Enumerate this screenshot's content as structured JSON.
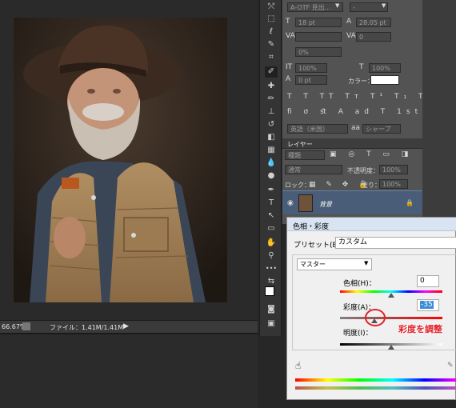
{
  "document": {
    "zoom": "66.67%",
    "file_info": "ファイル：1.41M/1.41M"
  },
  "character_panel": {
    "font_family": "A-OTF 見出...",
    "font_style": "-",
    "font_size": "18 pt",
    "leading": "28.05 pt",
    "kerning": "",
    "tracking": "0",
    "tsume": "0%",
    "vertical_scale": "100%",
    "horizontal_scale": "100%",
    "baseline_shift": "0 pt",
    "color_label": "カラー：",
    "language": "英語（米国）",
    "antialias": "シャープ"
  },
  "layers_panel": {
    "tab": "レイヤー",
    "filter": "種類",
    "blend_mode": "通常",
    "opacity_label": "不透明度：",
    "opacity_value": "100%",
    "lock_label": "ロック：",
    "fill_label": "塗り：",
    "fill_value": "100%",
    "layer_name": "背景"
  },
  "hue_sat_dialog": {
    "title": "色相・彩度",
    "preset_label": "プリセット(E)：",
    "preset_value": "カスタム",
    "channel": "マスター",
    "hue_label": "色相(H)：",
    "hue_value": "0",
    "saturation_label": "彩度(A)：",
    "saturation_value": "-35",
    "lightness_label": "明度(I)：",
    "lightness_value": "0"
  },
  "annotation": "彩度を調整",
  "colors": {
    "highlight_blue": "#3d8cd8",
    "annotation_red": "#e0202a",
    "layer_selected": "#4a5d78"
  }
}
